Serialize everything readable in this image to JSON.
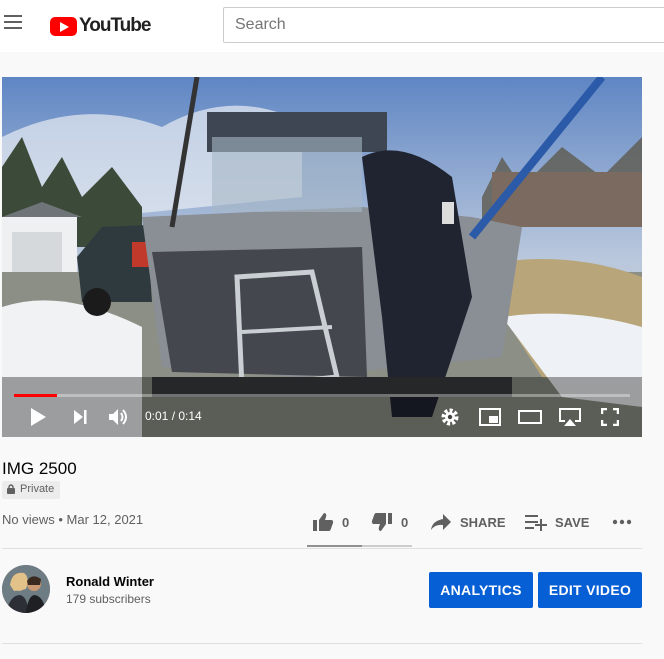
{
  "header": {
    "menu_icon": "hamburger-menu-icon",
    "logo_text": "YouTube",
    "search_placeholder": "Search"
  },
  "player": {
    "progress_fraction": 0.07,
    "time_current": "0:01",
    "time_separator": " / ",
    "time_total": "0:14",
    "controls": [
      "play-icon",
      "next-icon",
      "volume-icon",
      "settings-icon",
      "miniplayer-icon",
      "theater-icon",
      "airplay-icon",
      "fullscreen-icon"
    ],
    "accent_color": "#ff0000"
  },
  "video": {
    "title": "IMG 2500",
    "privacy": "Private",
    "views": "No views",
    "date_separator": " • ",
    "date": "Mar 12, 2021"
  },
  "actions": {
    "like_count": "0",
    "dislike_count": "0",
    "share_label": "SHARE",
    "save_label": "SAVE"
  },
  "channel": {
    "name": "Ronald Winter",
    "subscribers": "179 subscribers"
  },
  "buttons": {
    "analytics": "ANALYTICS",
    "edit_video": "EDIT VIDEO",
    "color": "#065fd4"
  }
}
